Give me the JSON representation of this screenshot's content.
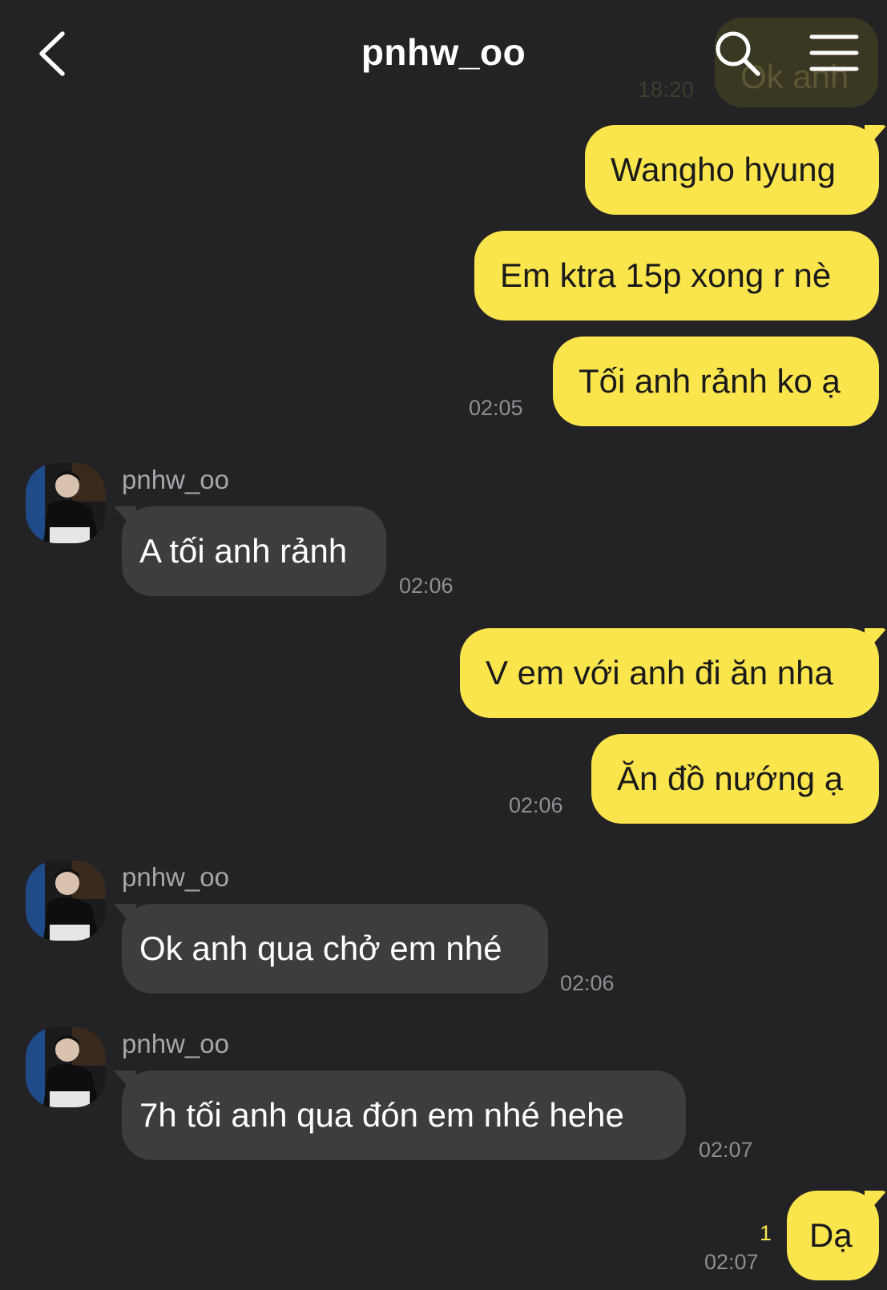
{
  "header": {
    "title": "pnhw_oo",
    "back_icon": "chevron-left-icon",
    "search_icon": "search-icon",
    "menu_icon": "menu-icon"
  },
  "colors": {
    "background": "#232326",
    "my_bubble": "#fbe54d",
    "their_bubble": "#3d3d40",
    "timestamp": "#8e8e93",
    "unread": "#fbe54d"
  },
  "previous": {
    "text": "Ok anh",
    "time": "18:20"
  },
  "messages": [
    {
      "from": "me",
      "text": "Wangho hyung"
    },
    {
      "from": "me",
      "text": "Em ktra 15p xong r nè"
    },
    {
      "from": "me",
      "text": "Tối anh rảnh ko ạ",
      "time": "02:05"
    },
    {
      "from": "them",
      "sender": "pnhw_oo",
      "text": "A tối anh rảnh",
      "time": "02:06"
    },
    {
      "from": "me",
      "text": "V em với anh đi ăn nha"
    },
    {
      "from": "me",
      "text": "Ăn đồ nướng ạ",
      "time": "02:06"
    },
    {
      "from": "them",
      "sender": "pnhw_oo",
      "text": "Ok anh qua chở em nhé",
      "time": "02:06"
    },
    {
      "from": "them",
      "sender": "pnhw_oo",
      "text": "7h tối anh qua đón em nhé hehe",
      "time": "02:07"
    },
    {
      "from": "me",
      "text": "Dạ",
      "time": "02:07",
      "unread": "1"
    }
  ]
}
